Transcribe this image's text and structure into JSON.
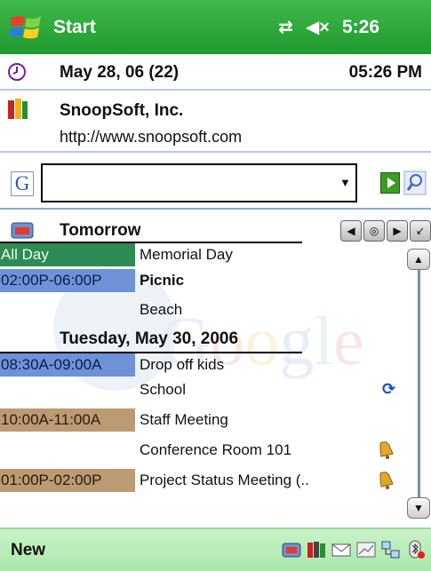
{
  "topbar": {
    "title": "Start",
    "time": "5:26",
    "connectivity_icon": "sync-arrows-icon",
    "volume_icon": "volume-muted-icon"
  },
  "datebar": {
    "date": "May 28, 06 (22)",
    "time": "05:26 PM"
  },
  "owner": {
    "name": "SnoopSoft, Inc.",
    "url": "http://www.snoopsoft.com"
  },
  "search": {
    "value": "",
    "engine_icon": "google-g-icon"
  },
  "agenda": {
    "days": [
      {
        "label": "Tomorrow",
        "events": [
          {
            "time": "All Day",
            "title": "Memorial Day",
            "bold": false
          },
          {
            "time": "02:00P-06:00P",
            "title": "Picnic",
            "location": "Beach",
            "bold": true
          }
        ]
      },
      {
        "label": "Tuesday, May 30, 2006",
        "events": [
          {
            "time": "08:30A-09:00A",
            "title": "Drop off kids",
            "location": "School",
            "recurring": true
          },
          {
            "time": "10:00A-11:00A",
            "title": "Staff Meeting",
            "location": "Conference Room 101",
            "alarm": true
          },
          {
            "time": "01:00P-02:00P",
            "title": "Project Status Meeting (..",
            "alarm": true
          }
        ]
      }
    ],
    "watermark": "Google"
  },
  "bottombar": {
    "left_label": "New"
  },
  "colors": {
    "header_green": "#2aa838",
    "bottom_green": "#b9eeb9",
    "allday": "#2e8b57",
    "blue_slot": "#6e91d8",
    "tan_slot": "#bc9a73"
  }
}
